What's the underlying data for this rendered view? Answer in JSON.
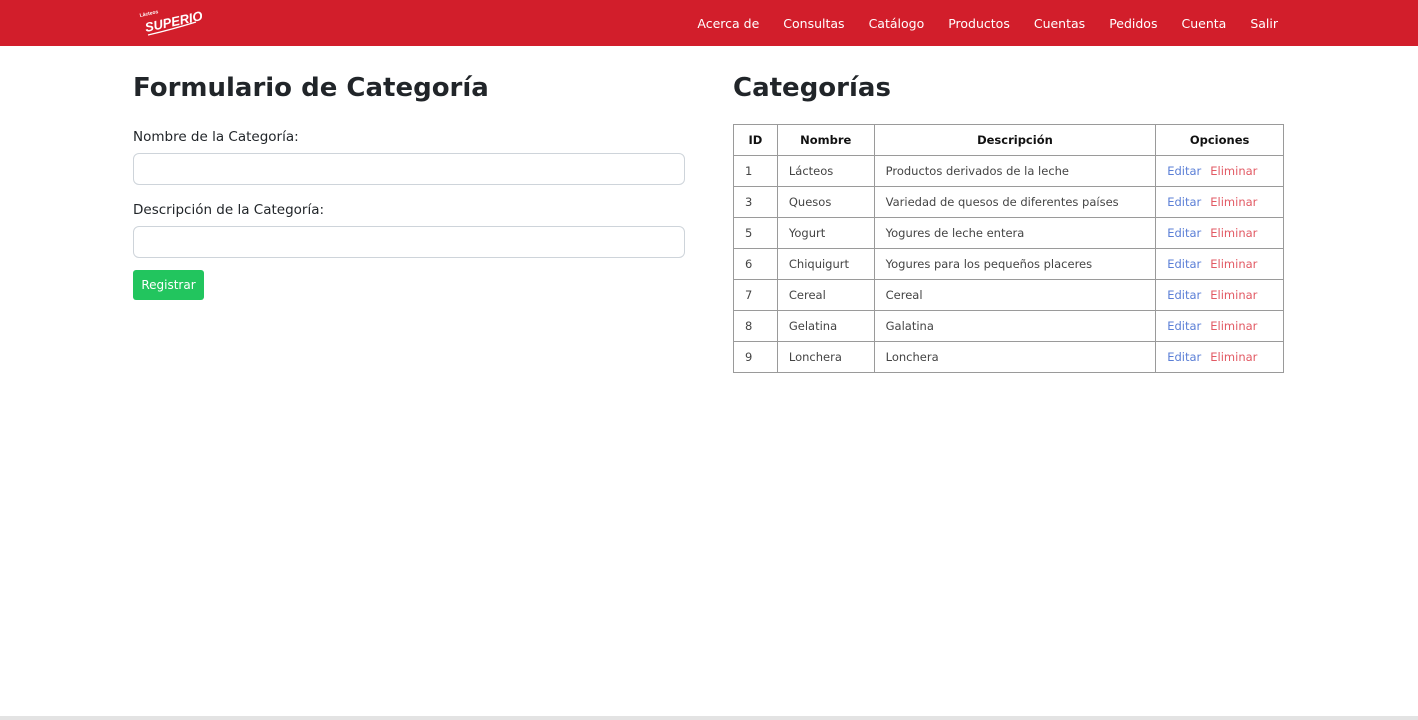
{
  "brand": {
    "logo_text_small": "Lácteos",
    "logo_text_main": "Superior",
    "color": "#d21e2b"
  },
  "nav": {
    "items": [
      "Acerca de",
      "Consultas",
      "Catálogo",
      "Productos",
      "Cuentas",
      "Pedidos",
      "Cuenta",
      "Salir"
    ]
  },
  "form": {
    "title": "Formulario de Categoría",
    "name_label": "Nombre de la Categoría:",
    "name_value": "",
    "description_label": "Descripción de la Categoría:",
    "description_value": "",
    "submit_label": "Registrar",
    "submit_color": "#22c55e"
  },
  "table": {
    "title": "Categorías",
    "headers": [
      "ID",
      "Nombre",
      "Descripción",
      "Opciones"
    ],
    "edit_label": "Editar",
    "delete_label": "Eliminar",
    "rows": [
      {
        "id": "1",
        "name": "Lácteos",
        "description": "Productos derivados de la leche"
      },
      {
        "id": "3",
        "name": "Quesos",
        "description": "Variedad de quesos de diferentes países"
      },
      {
        "id": "5",
        "name": "Yogurt",
        "description": "Yogures de leche entera"
      },
      {
        "id": "6",
        "name": "Chiquigurt",
        "description": "Yogures para los pequeños placeres"
      },
      {
        "id": "7",
        "name": "Cereal",
        "description": "Cereal"
      },
      {
        "id": "8",
        "name": "Gelatina",
        "description": "Galatina"
      },
      {
        "id": "9",
        "name": "Lonchera",
        "description": "Lonchera"
      }
    ]
  }
}
